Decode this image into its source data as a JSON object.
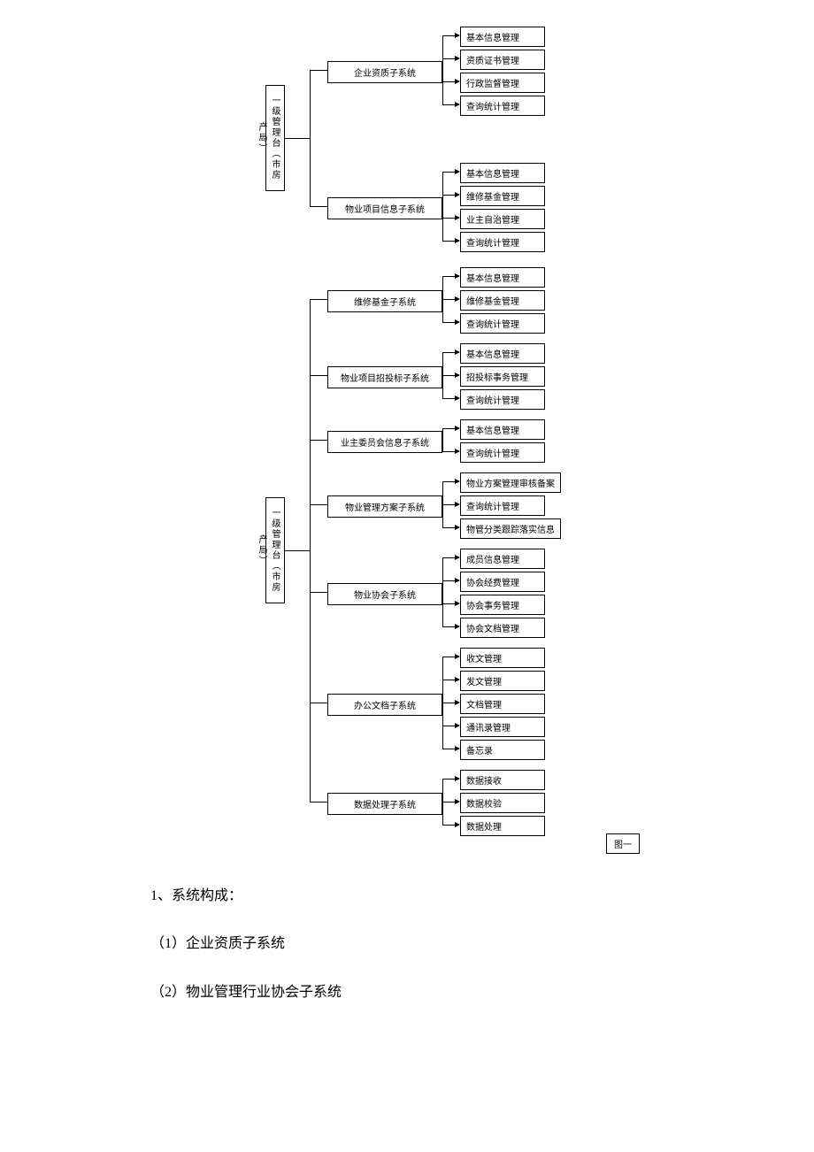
{
  "roots": [
    {
      "label": "一级管理台（市房产局）"
    },
    {
      "label": "一级管理台（市房产局）"
    }
  ],
  "mids": [
    {
      "label": "企业资质子系统"
    },
    {
      "label": "物业项目信息子系统"
    },
    {
      "label": "维修基金子系统"
    },
    {
      "label": "物业项目招投标子系统"
    },
    {
      "label": "业主委员会信息子系统"
    },
    {
      "label": "物业管理方案子系统"
    },
    {
      "label": "物业协会子系统"
    },
    {
      "label": "办公文档子系统"
    },
    {
      "label": "数据处理子系统"
    }
  ],
  "leaves": {
    "g0": [
      "基本信息管理",
      "资质证书管理",
      "行政监督管理",
      "查询统计管理"
    ],
    "g1": [
      "基本信息管理",
      "维修基金管理",
      "业主自治管理",
      "查询统计管理"
    ],
    "g2": [
      "基本信息管理",
      "维修基金管理",
      "查询统计管理"
    ],
    "g3": [
      "基本信息管理",
      "招投标事务管理",
      "查询统计管理"
    ],
    "g4": [
      "基本信息管理",
      "查询统计管理"
    ],
    "g5": [
      "物业方案管理审核备案",
      "查询统计管理",
      "物管分类跟踪落实信息"
    ],
    "g6": [
      "成员信息管理",
      "协会经费管理",
      "协会事务管理",
      "协会文档管理"
    ],
    "g7": [
      "收文管理",
      "发文管理",
      "文档管理",
      "通讯录管理",
      "备忘录"
    ],
    "g8": [
      "数据接收",
      "数据校验",
      "数据处理"
    ]
  },
  "caption": "图一",
  "text": {
    "heading": "1、系统构成：",
    "item1": "（1）企业资质子系统",
    "item2": "（2）物业管理行业协会子系统"
  }
}
